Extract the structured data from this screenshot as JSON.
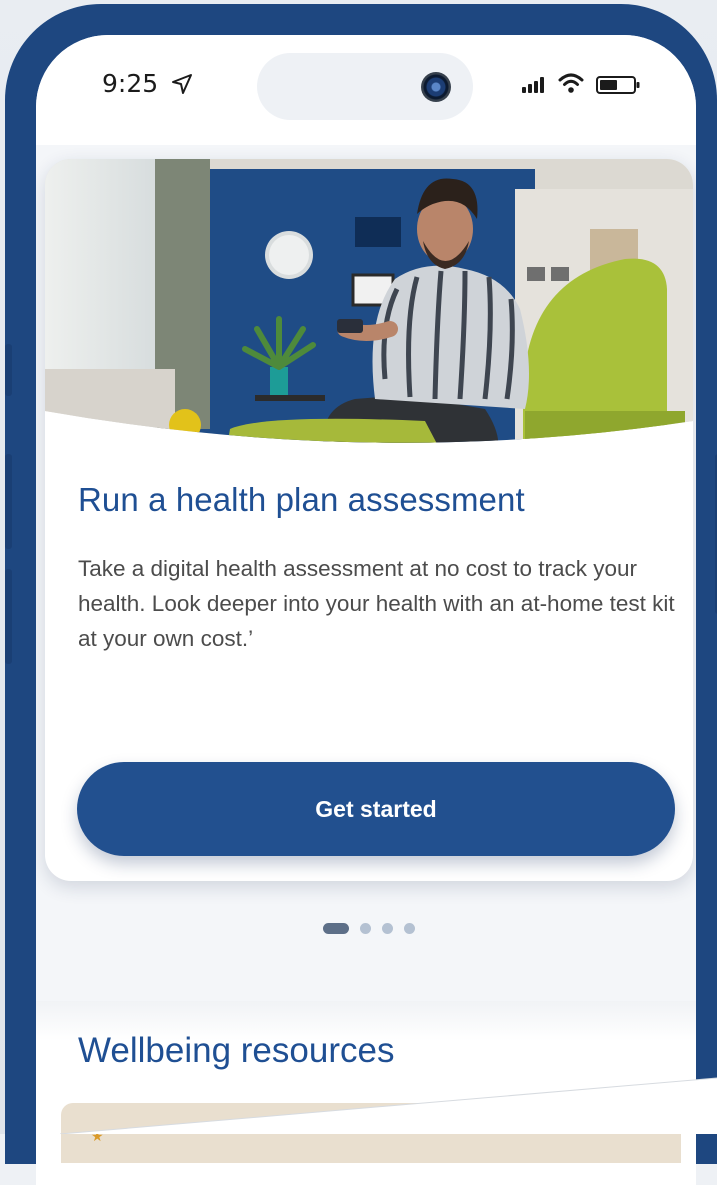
{
  "status_bar": {
    "time": "9:25",
    "icons": [
      "location-arrow-icon",
      "signal-icon",
      "wifi-icon",
      "battery-icon"
    ]
  },
  "hero": {
    "image": "man-smiling-at-phone-in-living-room",
    "title": "Run a health plan assessment",
    "body": "Take a digital health assessment at no cost to track your health. Look deeper into your health with an at-home test kit at your own cost.’",
    "button_label": "Get started"
  },
  "carousel": {
    "pages": 4,
    "active": 1
  },
  "section": {
    "title": "Wellbeing resources"
  },
  "colors": {
    "brand": "#1e4780",
    "title": "#1f4f93",
    "button": "#22508f",
    "body_text": "#4c4c4c"
  }
}
